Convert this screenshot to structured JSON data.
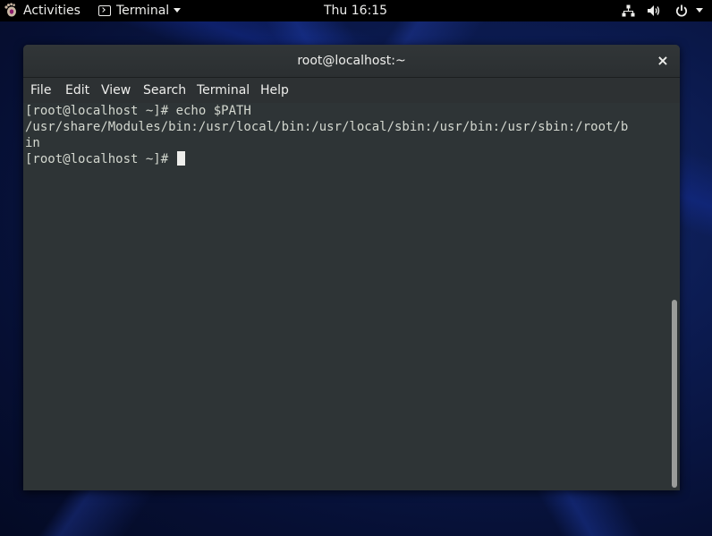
{
  "topbar": {
    "activities_label": "Activities",
    "app_name": "Terminal",
    "clock": "Thu 16:15",
    "status_icons": [
      "network-icon",
      "volume-icon",
      "power-icon",
      "chevron-down-icon"
    ]
  },
  "window": {
    "title": "root@localhost:~",
    "close_glyph": "×",
    "menu": [
      "File",
      "Edit",
      "View",
      "Search",
      "Terminal",
      "Help"
    ]
  },
  "terminal": {
    "lines": [
      "[root@localhost ~]# echo $PATH",
      "/usr/share/Modules/bin:/usr/local/bin:/usr/local/sbin:/usr/bin:/usr/sbin:/root/b",
      "in",
      "[root@localhost ~]# "
    ]
  },
  "colors": {
    "terminal_bg": "#2e3436",
    "terminal_fg": "#d3d7cf",
    "topbar_bg": "#000000"
  }
}
